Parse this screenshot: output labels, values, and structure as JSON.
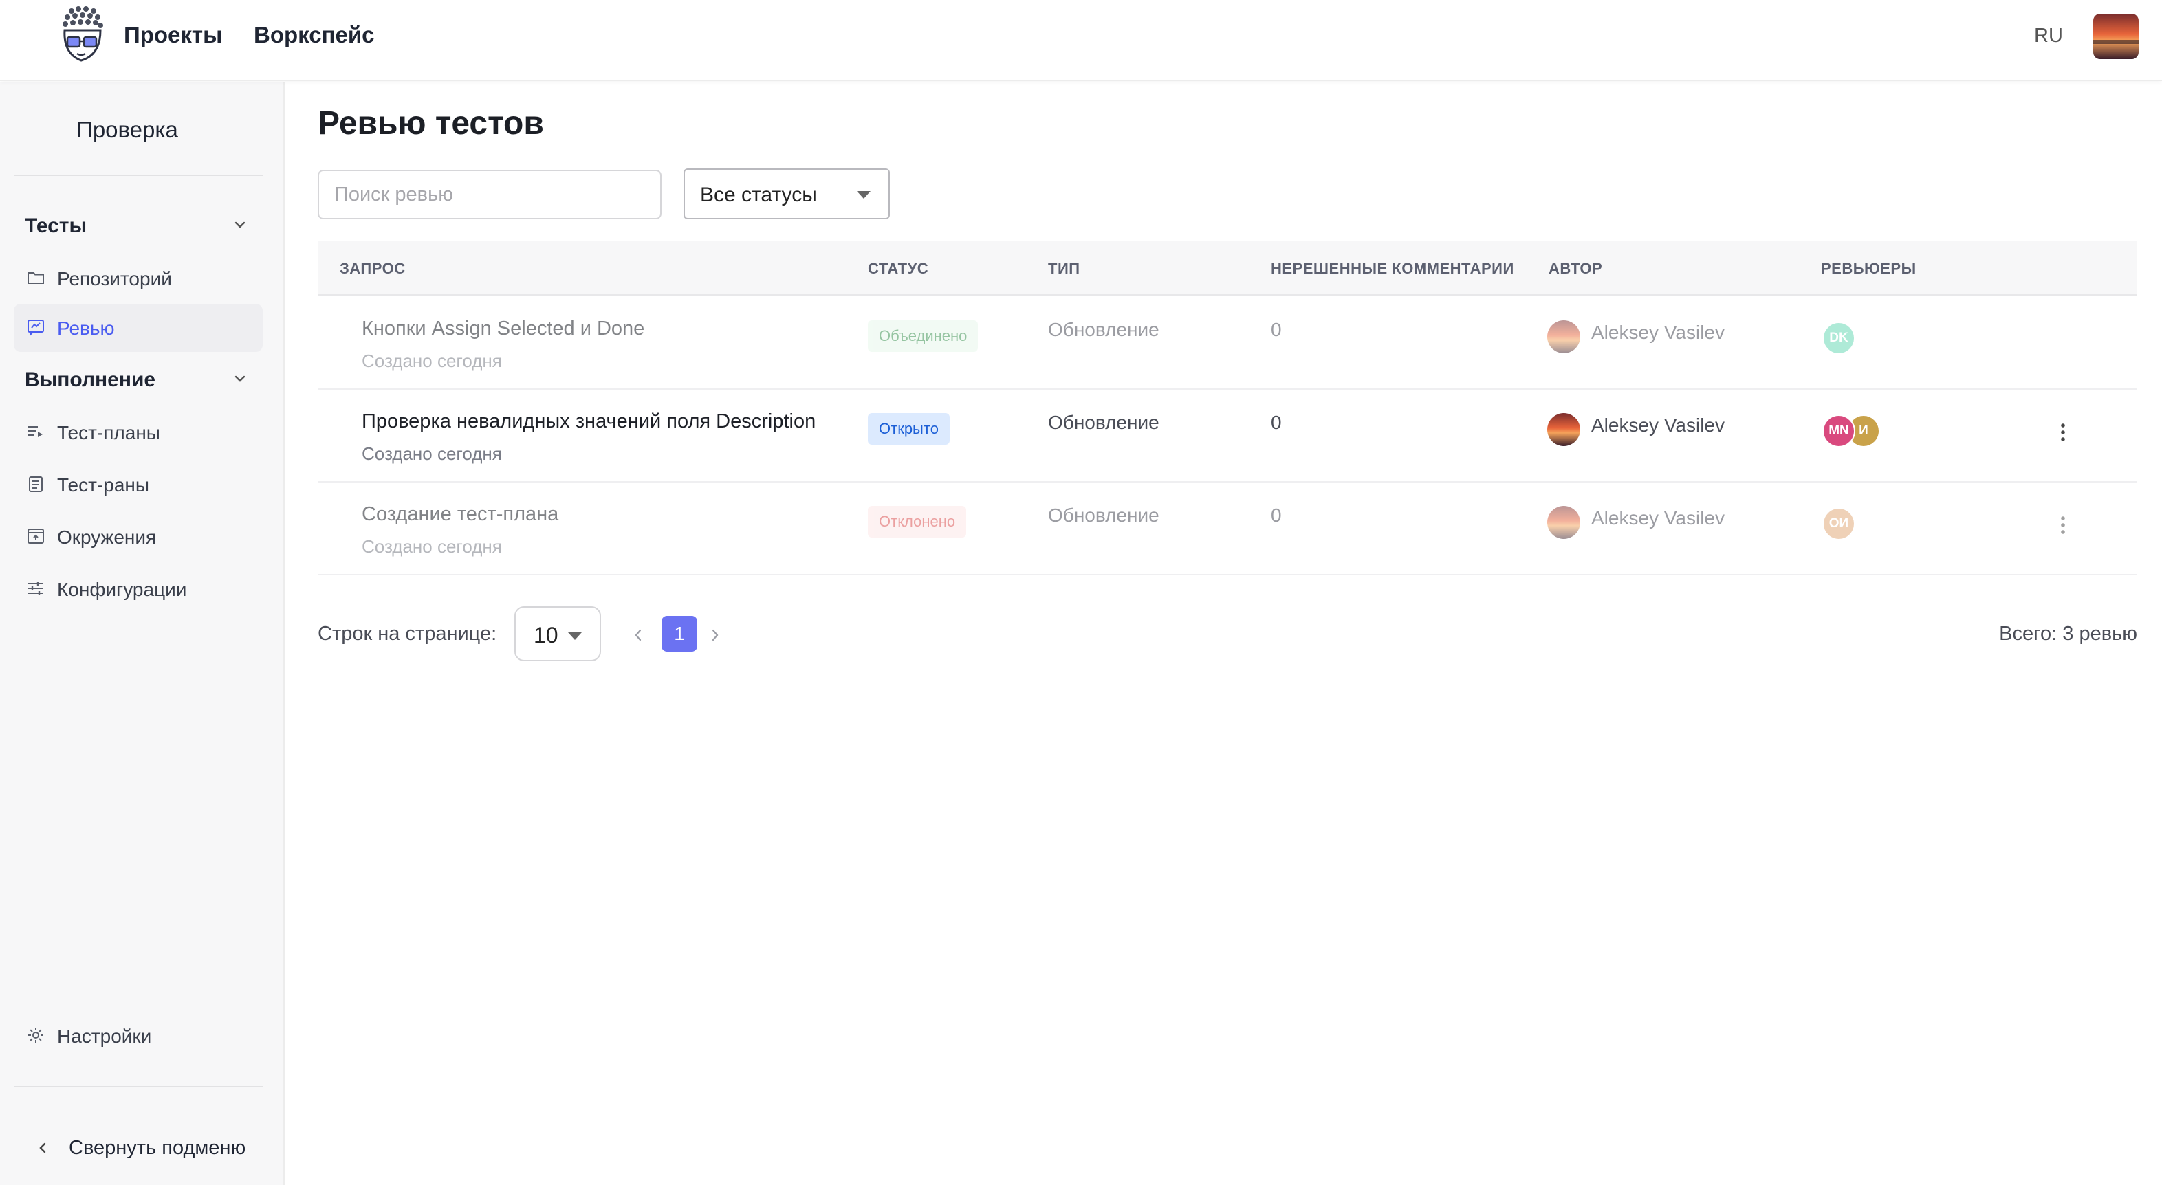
{
  "topbar": {
    "nav": [
      "Проекты",
      "Воркспейс"
    ],
    "lang": "RU"
  },
  "sidebar": {
    "title": "Проверка",
    "sections": [
      {
        "label": "Тесты",
        "items": [
          {
            "label": "Репозиторий",
            "icon": "folder-icon",
            "active": false
          },
          {
            "label": "Ревью",
            "icon": "review-icon",
            "active": true
          }
        ]
      },
      {
        "label": "Выполнение",
        "items": [
          {
            "label": "Тест-планы",
            "icon": "list-icon",
            "active": false
          },
          {
            "label": "Тест-раны",
            "icon": "clipboard-icon",
            "active": false
          },
          {
            "label": "Окружения",
            "icon": "window-icon",
            "active": false
          },
          {
            "label": "Конфигурации",
            "icon": "sliders-icon",
            "active": false
          }
        ]
      }
    ],
    "settings": "Настройки",
    "collapse": "Свернуть подменю"
  },
  "main": {
    "title": "Ревью тестов",
    "search_placeholder": "Поиск ревью",
    "status_filter": "Все статусы",
    "columns": [
      "Запрос",
      "Статус",
      "Тип",
      "Нерешенные комментарии",
      "Автор",
      "Ревьюеры"
    ],
    "rows": [
      {
        "title": "Кнопки Assign Selected и Done",
        "created": "Создано сегодня",
        "status": "Объединено",
        "type": "Обновление",
        "comments": "0",
        "author": "Aleksey Vasilev",
        "reviewers": [
          "DK"
        ]
      },
      {
        "title": "Проверка невалидных значений поля Description",
        "created": "Создано сегодня",
        "status": "Открыто",
        "type": "Обновление",
        "comments": "0",
        "author": "Aleksey Vasilev",
        "reviewers": [
          "MN",
          "И"
        ]
      },
      {
        "title": "Создание тест-плана",
        "created": "Создано сегодня",
        "status": "Отклонено",
        "type": "Обновление",
        "comments": "0",
        "author": "Aleksey Vasilev",
        "reviewers": [
          "ОИ"
        ]
      }
    ]
  },
  "pagination": {
    "rows_label": "Строк на странице:",
    "rows_per_page": "10",
    "current_page": "1",
    "total": "Всего: 3 ревью"
  },
  "colors": {
    "accent": "#4a5cf0",
    "page_button": "#6b72f2",
    "merged": "#2e8b46",
    "open": "#1c5fd6",
    "rejected": "#d84444",
    "reviewer_dk": "#5fd6b0",
    "reviewer_mn": "#d9497e",
    "reviewer_i": "#c9a24a",
    "reviewer_oi": "#e0a472"
  }
}
